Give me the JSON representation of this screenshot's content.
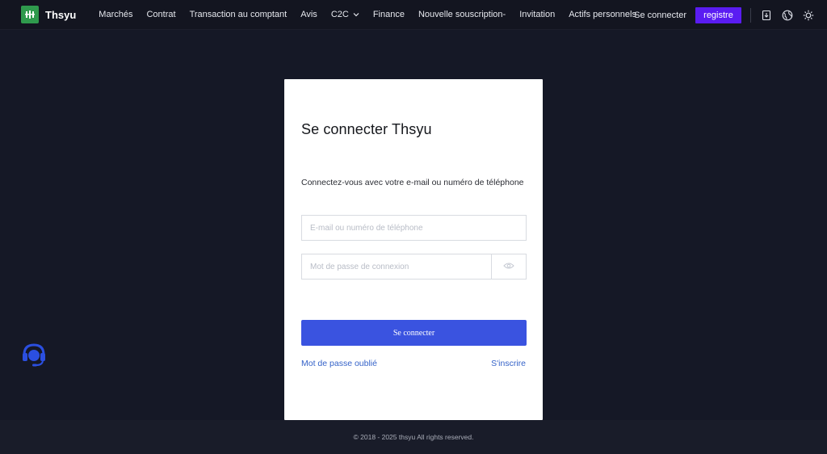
{
  "brand": {
    "name": "Thsyu",
    "logo_color": "#2f9a4d"
  },
  "nav": {
    "items": [
      {
        "label": "Marchés"
      },
      {
        "label": "Contrat"
      },
      {
        "label": "Transaction au comptant"
      },
      {
        "label": "Avis"
      },
      {
        "label": "C2C",
        "has_dropdown": true
      },
      {
        "label": "Finance"
      },
      {
        "label": "Nouvelle souscription-"
      },
      {
        "label": "Invitation"
      },
      {
        "label": "Actifs personnels"
      }
    ],
    "login_label": "Se connecter",
    "register_label": "registre",
    "register_color": "#5a1cf2",
    "icons": [
      "download-icon",
      "globe-icon",
      "theme-sun-icon"
    ]
  },
  "login_card": {
    "title": "Se connecter Thsyu",
    "subtitle": "Connectez-vous avec votre e-mail ou numéro de téléphone",
    "email_placeholder": "E-mail ou numéro de téléphone",
    "email_value": "",
    "password_placeholder": "Mot de passe de connexion",
    "password_value": "",
    "submit_label": "Se connecter",
    "submit_color": "#3a53e0",
    "forgot_label": "Mot de passe oublié",
    "signup_label": "S'inscrire",
    "link_color": "#3462c8"
  },
  "support": {
    "icon": "headset-support-icon",
    "color": "#2b4fe0"
  },
  "footer": {
    "copyright": "© 2018 - 2025 thsyu All rights reserved."
  },
  "colors": {
    "page_bg": "#151826",
    "nav_bg": "#131520",
    "footer_bg": "#191c29"
  }
}
